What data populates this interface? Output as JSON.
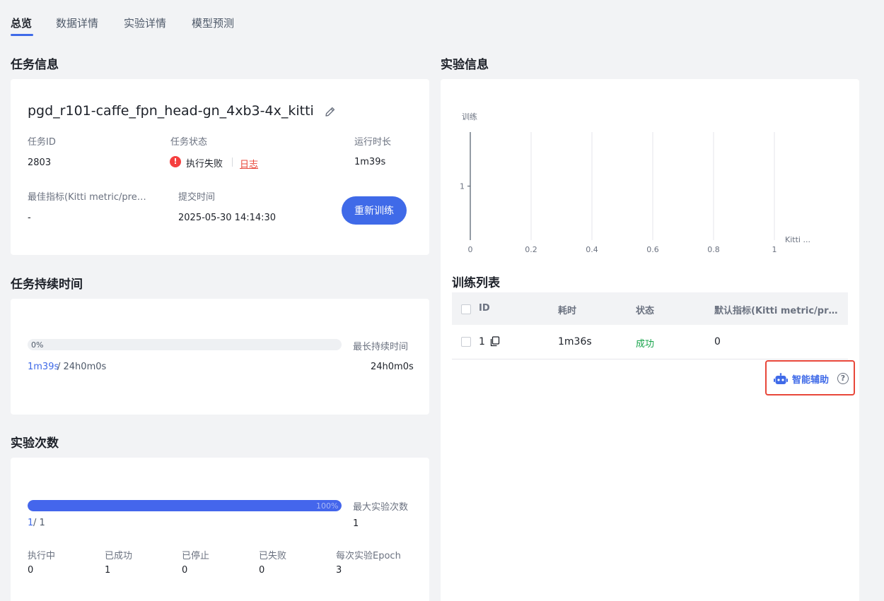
{
  "tabs": [
    {
      "label": "总览",
      "active": true
    },
    {
      "label": "数据详情",
      "active": false
    },
    {
      "label": "实验详情",
      "active": false
    },
    {
      "label": "模型预测",
      "active": false
    }
  ],
  "task_info": {
    "section_title": "任务信息",
    "task_name": "pgd_r101-caffe_fpn_head-gn_4xb3-4x_kitti",
    "task_id_label": "任务ID",
    "task_id": "2803",
    "status_label": "任务状态",
    "status_icon": "!",
    "status_text": "执行失败",
    "log_link": "日志",
    "runtime_label": "运行时长",
    "runtime": "1m39s",
    "best_metric_label": "最佳指标(Kitti metric/pre…",
    "best_metric": "-",
    "submit_time_label": "提交时间",
    "submit_time": "2025-05-30 14:14:30",
    "retrain_button": "重新训练"
  },
  "duration": {
    "section_title": "任务持续时间",
    "progress_fraction": 0.0,
    "progress_text": "0%",
    "current": "1m39s",
    "current_suffix": "/ 24h0m0s",
    "max_label": "最长持续时间",
    "max_value": "24h0m0s"
  },
  "experiment_count": {
    "section_title": "实验次数",
    "progress_fraction": 1.0,
    "progress_text": "100%",
    "current": "1",
    "current_suffix": "/ 1",
    "max_label": "最大实验次数",
    "max_value": "1",
    "stats": [
      {
        "label": "执行中",
        "value": "0"
      },
      {
        "label": "已成功",
        "value": "1"
      },
      {
        "label": "已停止",
        "value": "0"
      },
      {
        "label": "已失败",
        "value": "0"
      },
      {
        "label": "每次实验Epoch",
        "value": "3"
      }
    ]
  },
  "experiment_info": {
    "section_title": "实验信息",
    "chart_data": {
      "type": "scatter",
      "ylabel": "训练",
      "xlabel": "Kitti ...",
      "x_ticks": [
        "0",
        "0.2",
        "0.4",
        "0.6",
        "0.8",
        "1"
      ],
      "y_ticks": [
        "1"
      ],
      "xlim": [
        0,
        1
      ],
      "ylim": [
        0,
        2
      ],
      "grid": true,
      "series": []
    },
    "table_title": "训练列表",
    "columns": [
      "ID",
      "耗时",
      "状态",
      "默认指标(Kitti metric/pr…"
    ],
    "rows": [
      {
        "id": "1",
        "duration": "1m36s",
        "status": "成功",
        "metric": "0"
      }
    ],
    "assist_label": "智能辅助",
    "help_icon": "?",
    "colors": {
      "accent": "#3f6ae8",
      "success": "#16a34a",
      "error": "#f53f3f",
      "highlight_border": "#e8473a"
    }
  }
}
